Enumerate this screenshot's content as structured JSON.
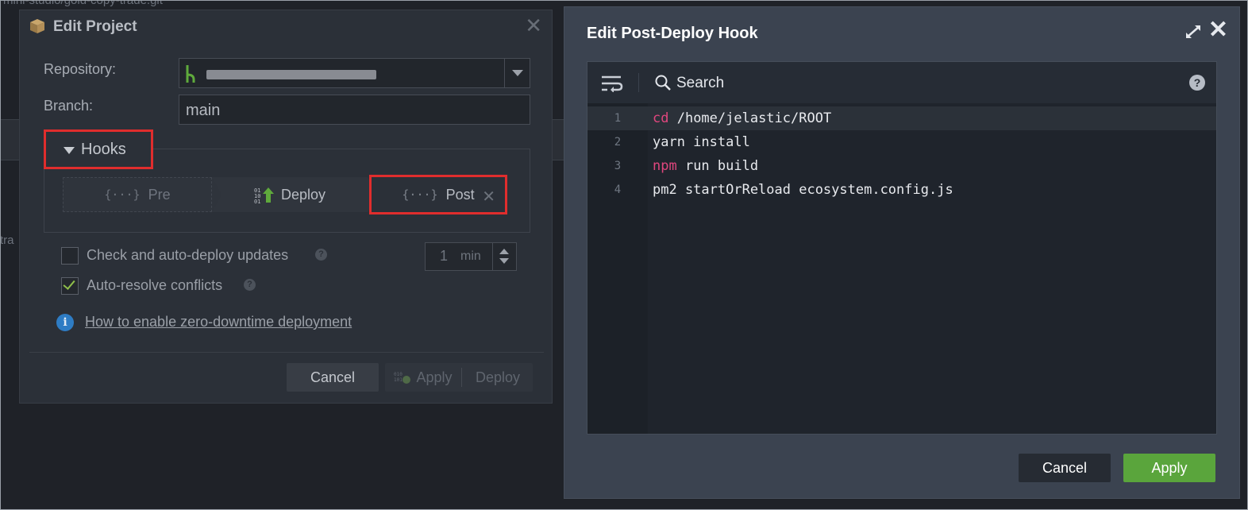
{
  "background": {
    "path_text": "mini-studio/gold-copy-trade.git",
    "side_text": "tra"
  },
  "edit_project": {
    "title": "Edit Project",
    "repository_label": "Repository:",
    "branch_label": "Branch:",
    "branch_value": "main",
    "hooks_label": "Hooks",
    "tabs": [
      {
        "label": "Pre",
        "icon": "{···}"
      },
      {
        "label": "Deploy",
        "icon": "deploy-icon"
      },
      {
        "label": "Post",
        "icon": "{···}"
      }
    ],
    "auto_deploy_label": "Check and auto-deploy updates",
    "auto_deploy_checked": false,
    "interval_value": "1",
    "interval_unit": "min",
    "auto_resolve_label": "Auto-resolve conflicts",
    "auto_resolve_checked": true,
    "zero_downtime_link": "How to enable zero-downtime deployment",
    "cancel_label": "Cancel",
    "apply_label": "Apply",
    "deploy_label": "Deploy"
  },
  "hook_editor": {
    "title": "Edit Post-Deploy Hook",
    "search_label": "Search",
    "lines": [
      {
        "num": "1",
        "keyword": "cd",
        "rest": " /home/jelastic/ROOT"
      },
      {
        "num": "2",
        "keyword": "",
        "rest": "yarn install"
      },
      {
        "num": "3",
        "keyword": "npm",
        "rest": " run build"
      },
      {
        "num": "4",
        "keyword": "",
        "rest": "pm2 startOrReload ecosystem.config.js"
      }
    ],
    "cancel_label": "Cancel",
    "apply_label": "Apply"
  },
  "colors": {
    "highlight_border": "#e02d2d",
    "apply_green": "#5aa53c",
    "keyword_pink": "#e0467e",
    "link_info_blue": "#2e7cc4"
  }
}
